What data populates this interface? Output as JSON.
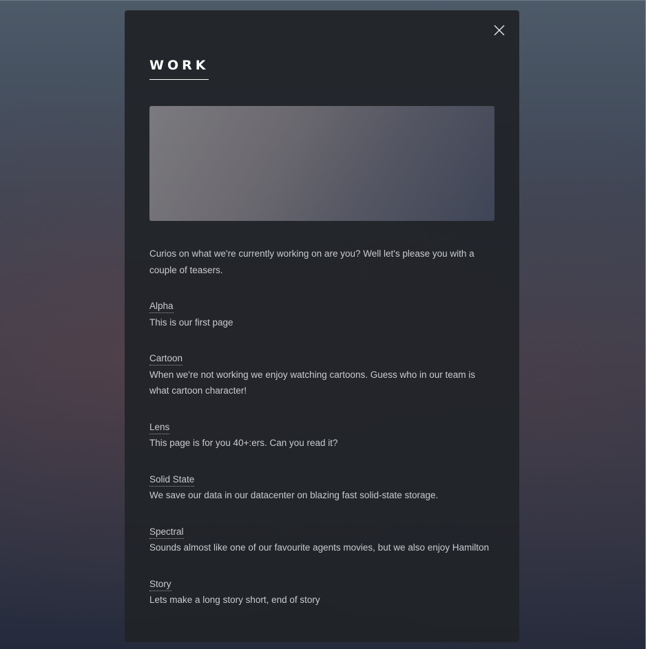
{
  "panel": {
    "title": "WORK",
    "close_icon": "close-icon",
    "image_placeholder": "gradient-image",
    "intro": "Curios on what we're currently working on are you? Well let's please you with a couple of teasers.",
    "items": [
      {
        "label": "Alpha",
        "desc": "This is our first page"
      },
      {
        "label": "Cartoon",
        "desc": "When we're not working we enjoy watching cartoons. Guess who in our team is what cartoon character!"
      },
      {
        "label": "Lens",
        "desc": "This page is for you 40+:ers. Can you read it?"
      },
      {
        "label": "Solid State",
        "desc": "We save our data in our datacenter on blazing fast solid-state storage."
      },
      {
        "label": "Spectral",
        "desc": "Sounds almost like one of our favourite agents movies, but we also enjoy Hamilton"
      },
      {
        "label": "Story",
        "desc": "Lets make a long story short, end of story"
      }
    ]
  },
  "colors": {
    "panel_bg": "#202328",
    "text": "#c9cbce",
    "title": "#ffffff"
  }
}
